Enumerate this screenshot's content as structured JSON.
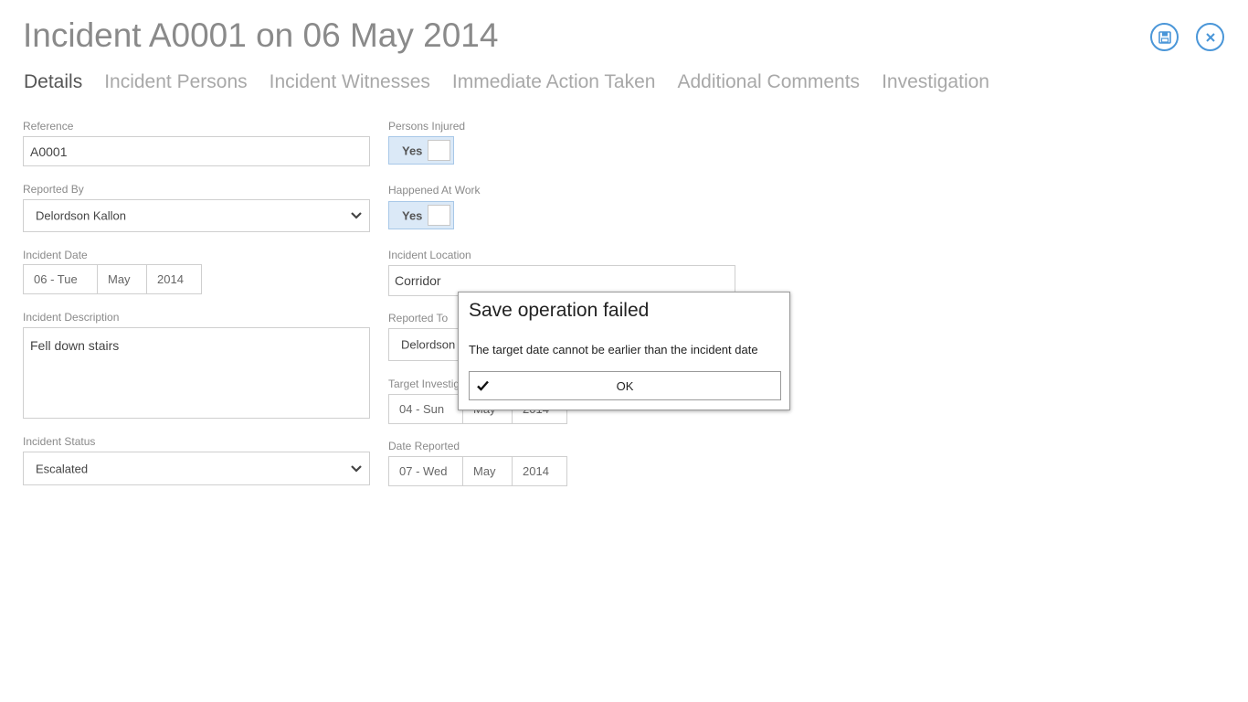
{
  "header": {
    "title": "Incident A0001 on 06 May 2014",
    "save_icon": "save-icon",
    "close_icon": "close-icon",
    "accent_color": "#4a96d8"
  },
  "tabs": [
    {
      "label": "Details",
      "active": true
    },
    {
      "label": "Incident Persons",
      "active": false
    },
    {
      "label": "Incident Witnesses",
      "active": false
    },
    {
      "label": "Immediate Action Taken",
      "active": false
    },
    {
      "label": "Additional Comments",
      "active": false
    },
    {
      "label": "Investigation",
      "active": false
    }
  ],
  "form": {
    "reference": {
      "label": "Reference",
      "value": "A0001"
    },
    "reported_by": {
      "label": "Reported By",
      "value": "Delordson Kallon"
    },
    "incident_date": {
      "label": "Incident Date",
      "day": "06 - Tue",
      "month": "May",
      "year": "2014"
    },
    "incident_description": {
      "label": "Incident Description",
      "value": "Fell down stairs"
    },
    "incident_status": {
      "label": "Incident Status",
      "value": "Escalated"
    },
    "persons_injured": {
      "label": "Persons Injured",
      "value": "Yes"
    },
    "happened_at_work": {
      "label": "Happened At Work",
      "value": "Yes"
    },
    "incident_location": {
      "label": "Incident Location",
      "value": "Corridor"
    },
    "reported_to": {
      "label": "Reported To",
      "value": "Delordson"
    },
    "target_investigation": {
      "label": "Target Investig",
      "day": "04 - Sun",
      "month": "May",
      "year": "2014"
    },
    "date_reported": {
      "label": "Date Reported",
      "day": "07 - Wed",
      "month": "May",
      "year": "2014"
    }
  },
  "dialog": {
    "title": "Save operation failed",
    "message": "The target date cannot be earlier than the incident date",
    "ok_label": "OK"
  }
}
